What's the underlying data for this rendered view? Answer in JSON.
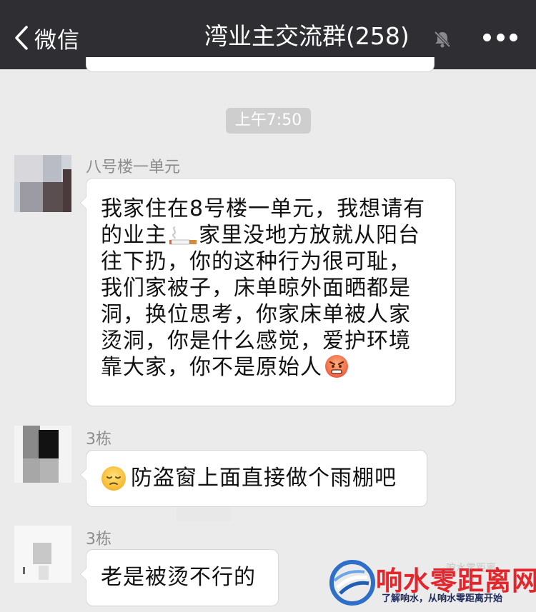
{
  "header": {
    "back_label": "微信",
    "title": "湾业主交流群(258)",
    "muted": true
  },
  "timestamp": "上午7:50",
  "messages": [
    {
      "sender": "八号楼一单元",
      "lines": [
        "我家住在8号楼一单元，我想请有",
        "的业主",
        "家里没地方放就从阳台",
        "往下扔，你的这种行为很可耻，",
        "我们家被子，床单晾外面晒都是",
        "洞，换位思考，你家床单被人家",
        "烫洞，你是什么感觉，爱护环境",
        "靠大家，你不是原始人"
      ],
      "inline_icons": [
        "cigarette-emoji",
        "angry-face-emoji"
      ]
    },
    {
      "sender": "3栋",
      "text": "防盗窗上面直接做个雨棚吧",
      "inline_icons": [
        "pensive-face-emoji"
      ]
    },
    {
      "sender": "3栋",
      "text": "老是被烫不行的"
    }
  ],
  "watermark": {
    "title": "响水零距离网",
    "subtitle": "了解响水，从响水零距离开始",
    "faint_text": "响水零距离"
  },
  "colors": {
    "navbar": "#2f2f33",
    "background": "#ebebeb",
    "bubble": "#ffffff",
    "watermark_red": "#e3262b",
    "watermark_blue": "#1f5fb5"
  }
}
